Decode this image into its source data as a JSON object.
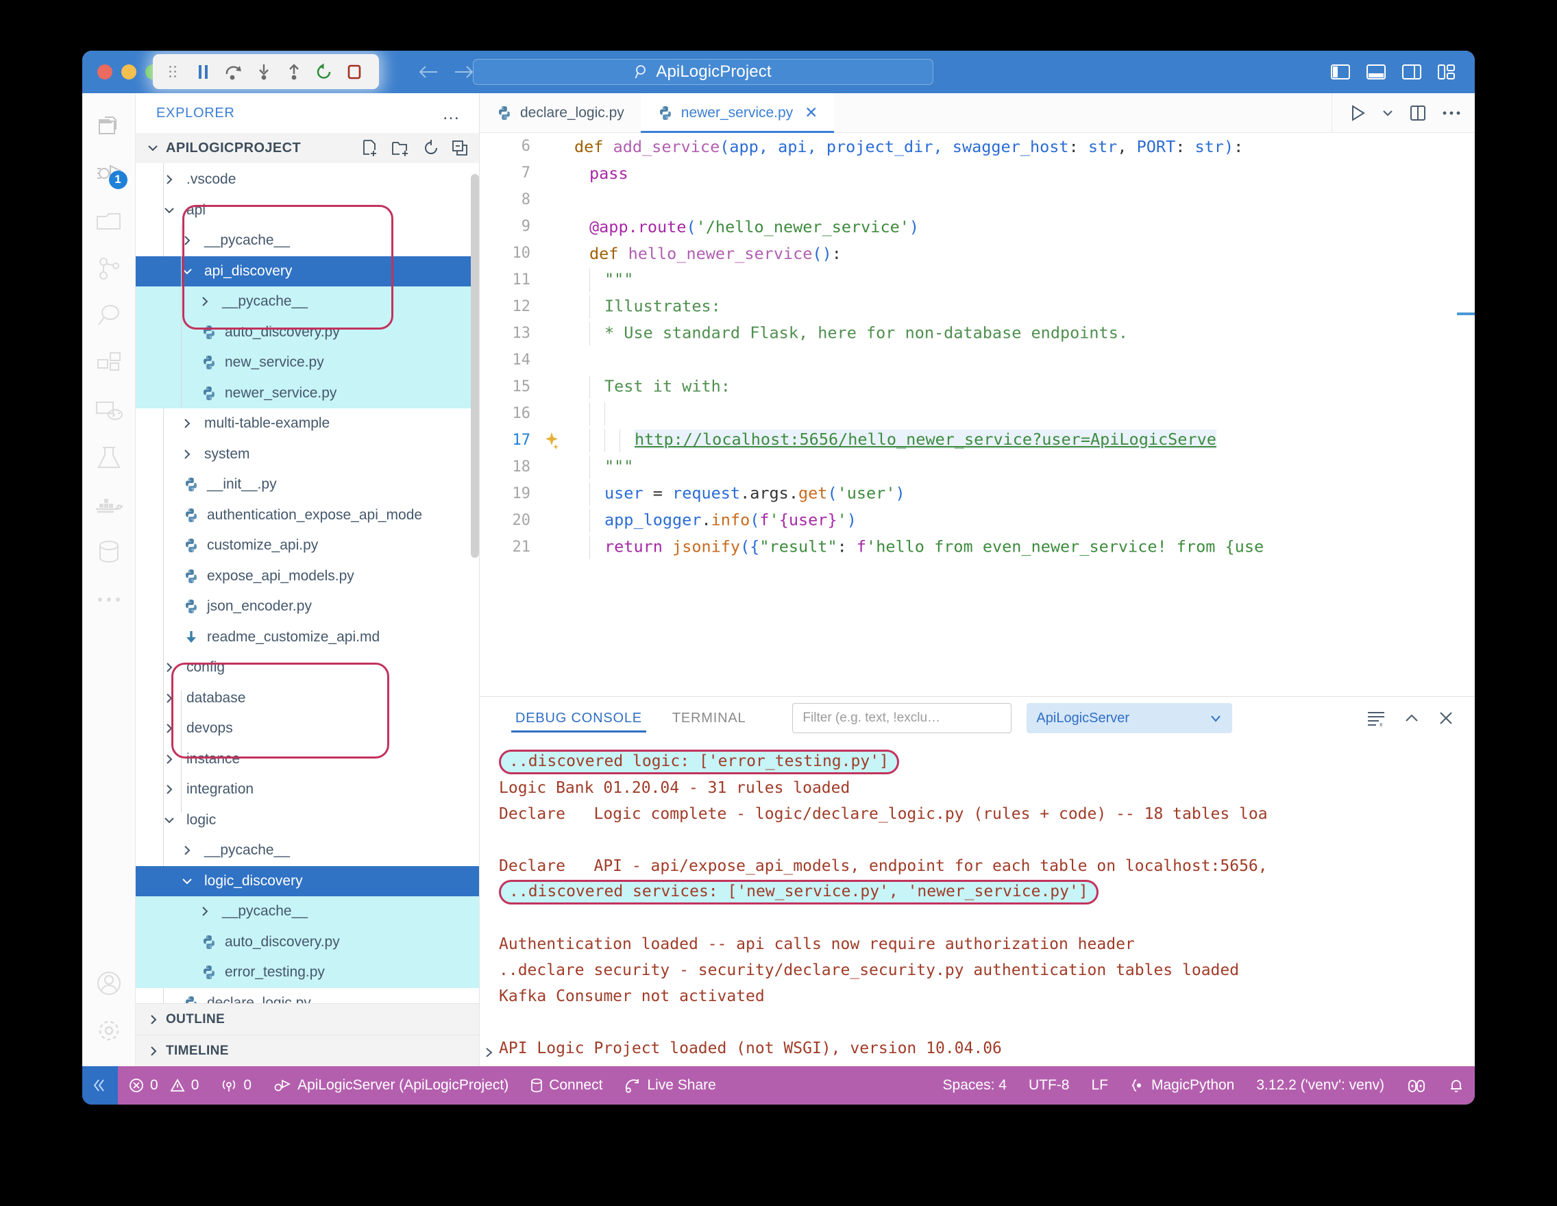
{
  "titlebar": {
    "project_title": "ApiLogicProject",
    "search_icon": "search-icon",
    "debug_buttons": [
      {
        "name": "drag-handle",
        "label": "drag"
      },
      {
        "name": "pause-button",
        "label": "Pause"
      },
      {
        "name": "step-over-button",
        "label": "Step Over"
      },
      {
        "name": "step-into-button",
        "label": "Step Into"
      },
      {
        "name": "step-out-button",
        "label": "Step Out"
      },
      {
        "name": "restart-button",
        "label": "Restart"
      },
      {
        "name": "stop-button",
        "label": "Stop"
      }
    ],
    "nav_back": "back-arrow-icon",
    "nav_forward": "forward-arrow-icon",
    "layout_icons": [
      "toggle-primary-sidebar-icon",
      "toggle-panel-icon",
      "toggle-secondary-sidebar-icon",
      "customize-layout-icon"
    ]
  },
  "activitybar": {
    "items": [
      {
        "name": "explorer",
        "badge": ""
      },
      {
        "name": "run-and-debug",
        "badge": "1"
      },
      {
        "name": "source-control",
        "badge": ""
      },
      {
        "name": "git-graph",
        "badge": ""
      },
      {
        "name": "search",
        "badge": ""
      },
      {
        "name": "extensions",
        "badge": ""
      },
      {
        "name": "remote-explorer",
        "badge": ""
      },
      {
        "name": "testing",
        "badge": ""
      },
      {
        "name": "docker",
        "badge": ""
      },
      {
        "name": "database",
        "badge": ""
      },
      {
        "name": "more-views",
        "badge": ""
      }
    ],
    "bottom": [
      {
        "name": "accounts"
      },
      {
        "name": "manage-settings"
      }
    ]
  },
  "sidebar": {
    "header_label": "EXPLORER",
    "more_actions": "…",
    "project_name": "APILOGICPROJECT",
    "project_actions": [
      "new-file-icon",
      "new-folder-icon",
      "refresh-icon",
      "collapse-all-icon"
    ],
    "tree": [
      {
        "label": ".vscode",
        "kind": "folder",
        "depth": 1,
        "expanded": false
      },
      {
        "label": "api",
        "kind": "folder",
        "depth": 1,
        "expanded": true
      },
      {
        "label": "__pycache__",
        "kind": "folder",
        "depth": 2,
        "expanded": false
      },
      {
        "label": "api_discovery",
        "kind": "folder",
        "depth": 2,
        "expanded": true,
        "selected": true,
        "highlighted": true
      },
      {
        "label": "__pycache__",
        "kind": "folder",
        "depth": 3,
        "expanded": false,
        "highlighted": true
      },
      {
        "label": "auto_discovery.py",
        "kind": "python",
        "depth": 3,
        "highlighted": true
      },
      {
        "label": "new_service.py",
        "kind": "python",
        "depth": 3,
        "highlighted": true
      },
      {
        "label": "newer_service.py",
        "kind": "python",
        "depth": 3,
        "highlighted": true
      },
      {
        "label": "multi-table-example",
        "kind": "folder",
        "depth": 2,
        "expanded": false
      },
      {
        "label": "system",
        "kind": "folder",
        "depth": 2,
        "expanded": false
      },
      {
        "label": "__init__.py",
        "kind": "python",
        "depth": 2
      },
      {
        "label": "authentication_expose_api_mode",
        "kind": "python",
        "depth": 2
      },
      {
        "label": "customize_api.py",
        "kind": "python",
        "depth": 2
      },
      {
        "label": "expose_api_models.py",
        "kind": "python",
        "depth": 2
      },
      {
        "label": "json_encoder.py",
        "kind": "python",
        "depth": 2
      },
      {
        "label": "readme_customize_api.md",
        "kind": "markdown",
        "depth": 2
      },
      {
        "label": "config",
        "kind": "folder",
        "depth": 1,
        "expanded": false
      },
      {
        "label": "database",
        "kind": "folder",
        "depth": 1,
        "expanded": false
      },
      {
        "label": "devops",
        "kind": "folder",
        "depth": 1,
        "expanded": false
      },
      {
        "label": "instance",
        "kind": "folder",
        "depth": 1,
        "expanded": false
      },
      {
        "label": "integration",
        "kind": "folder",
        "depth": 1,
        "expanded": false
      },
      {
        "label": "logic",
        "kind": "folder",
        "depth": 1,
        "expanded": true
      },
      {
        "label": "__pycache__",
        "kind": "folder",
        "depth": 2,
        "expanded": false
      },
      {
        "label": "logic_discovery",
        "kind": "folder",
        "depth": 2,
        "expanded": true,
        "selected": true,
        "highlighted": true
      },
      {
        "label": "__pycache__",
        "kind": "folder",
        "depth": 3,
        "expanded": false,
        "highlighted": true
      },
      {
        "label": "auto_discovery.py",
        "kind": "python",
        "depth": 3,
        "highlighted": true
      },
      {
        "label": "error_testing.py",
        "kind": "python",
        "depth": 3,
        "highlighted": true
      },
      {
        "label": "declare_logic.py",
        "kind": "python",
        "depth": 2
      }
    ],
    "sections": [
      {
        "label": "OUTLINE",
        "expanded": false
      },
      {
        "label": "TIMELINE",
        "expanded": false
      }
    ]
  },
  "editor": {
    "tabs": [
      {
        "label": "declare_logic.py",
        "active": false,
        "closable": false
      },
      {
        "label": "newer_service.py",
        "active": true,
        "closable": true
      }
    ],
    "actions": [
      "run-python-file-icon",
      "run-dropdown-icon",
      "split-editor-icon",
      "more-actions-icon"
    ],
    "lines": [
      {
        "num": "6",
        "tokens": [
          {
            "t": "def ",
            "c": "kd"
          },
          {
            "t": "add_service",
            "c": "fn"
          },
          {
            "t": "(",
            "c": "par"
          },
          {
            "t": "app, api, project_dir, swagger_host",
            "c": "vr"
          },
          {
            "t": ": ",
            "c": "op"
          },
          {
            "t": "str",
            "c": "vr"
          },
          {
            "t": ", ",
            "c": "op"
          },
          {
            "t": "PORT",
            "c": "vr"
          },
          {
            "t": ": ",
            "c": "op"
          },
          {
            "t": "str",
            "c": "vr"
          },
          {
            "t": ")",
            "c": "par"
          },
          {
            "t": ":",
            "c": "op"
          }
        ]
      },
      {
        "num": "7",
        "indent": 1,
        "tokens": [
          {
            "t": "pass",
            "c": "k"
          }
        ]
      },
      {
        "num": "8",
        "tokens": []
      },
      {
        "num": "9",
        "indent": 1,
        "tokens": [
          {
            "t": "@app",
            "c": "k"
          },
          {
            "t": ".route",
            "c": "k"
          },
          {
            "t": "(",
            "c": "par"
          },
          {
            "t": "'/hello_newer_service'",
            "c": "st"
          },
          {
            "t": ")",
            "c": "par"
          }
        ]
      },
      {
        "num": "10",
        "indent": 1,
        "tokens": [
          {
            "t": "def ",
            "c": "kd"
          },
          {
            "t": "hello_newer_service",
            "c": "fn"
          },
          {
            "t": "(",
            "c": "par"
          },
          {
            "t": ")",
            "c": "par"
          },
          {
            "t": ":",
            "c": "op"
          }
        ]
      },
      {
        "num": "11",
        "indent": 2,
        "tokens": [
          {
            "t": "\"\"\"",
            "c": "cm"
          }
        ]
      },
      {
        "num": "12",
        "indent": 2,
        "tokens": [
          {
            "t": "Illustrates:",
            "c": "cm"
          }
        ]
      },
      {
        "num": "13",
        "indent": 2,
        "tokens": [
          {
            "t": "* Use standard Flask, here for non-database endpoints.",
            "c": "cm"
          }
        ]
      },
      {
        "num": "14",
        "tokens": []
      },
      {
        "num": "15",
        "indent": 2,
        "tokens": [
          {
            "t": "Test it with:",
            "c": "cm"
          }
        ]
      },
      {
        "num": "16",
        "indent": 3,
        "tokens": []
      },
      {
        "num": "17",
        "indent": 4,
        "current": true,
        "sparkle": true,
        "tokens": [
          {
            "t": "http://localhost:5656/hello_newer_service?user=ApiLogicServe",
            "c": "url"
          }
        ]
      },
      {
        "num": "18",
        "indent": 2,
        "tokens": [
          {
            "t": "\"\"\"",
            "c": "cm"
          }
        ]
      },
      {
        "num": "19",
        "indent": 2,
        "tokens": [
          {
            "t": "user ",
            "c": "vr"
          },
          {
            "t": "= ",
            "c": "op"
          },
          {
            "t": "request",
            "c": "vr"
          },
          {
            "t": ".args.",
            "c": "op"
          },
          {
            "t": "get",
            "c": "fnc"
          },
          {
            "t": "(",
            "c": "par"
          },
          {
            "t": "'user'",
            "c": "st"
          },
          {
            "t": ")",
            "c": "par"
          }
        ]
      },
      {
        "num": "20",
        "indent": 2,
        "tokens": [
          {
            "t": "app_logger",
            "c": "vr"
          },
          {
            "t": ".",
            "c": "op"
          },
          {
            "t": "info",
            "c": "fnc"
          },
          {
            "t": "(",
            "c": "par"
          },
          {
            "t": "f",
            "c": "k"
          },
          {
            "t": "'",
            "c": "st"
          },
          {
            "t": "{user}",
            "c": "k"
          },
          {
            "t": "'",
            "c": "st"
          },
          {
            "t": ")",
            "c": "par"
          }
        ]
      },
      {
        "num": "21",
        "indent": 2,
        "tokens": [
          {
            "t": "return ",
            "c": "k"
          },
          {
            "t": "jsonify",
            "c": "fnc"
          },
          {
            "t": "(",
            "c": "par"
          },
          {
            "t": "{",
            "c": "par"
          },
          {
            "t": "\"result\"",
            "c": "st"
          },
          {
            "t": ": ",
            "c": "op"
          },
          {
            "t": "f",
            "c": "k"
          },
          {
            "t": "'hello from even_newer_service! from {use",
            "c": "st"
          }
        ]
      }
    ]
  },
  "panel": {
    "tabs": [
      {
        "label": "DEBUG CONSOLE",
        "active": true
      },
      {
        "label": "TERMINAL",
        "active": false
      }
    ],
    "filter_placeholder": "Filter (e.g. text, !exclu…",
    "session": "ApiLogicServer",
    "actions": [
      "clear-console-icon",
      "collapse-panel-icon",
      "close-panel-icon"
    ],
    "console_lines": [
      {
        "text": "..discovered logic: ['error_testing.py']",
        "highlighted": true
      },
      {
        "text": "Logic Bank 01.20.04 - 31 rules loaded"
      },
      {
        "text": "Declare   Logic complete - logic/declare_logic.py (rules + code) -- 18 tables loa"
      },
      {
        "text": ""
      },
      {
        "text": "Declare   API - api/expose_api_models, endpoint for each table on localhost:5656,"
      },
      {
        "text": "..discovered services: ['new_service.py', 'newer_service.py']",
        "highlighted": true
      },
      {
        "text": ""
      },
      {
        "text": "Authentication loaded -- api calls now require authorization header"
      },
      {
        "text": "..declare security - security/declare_security.py authentication tables loaded"
      },
      {
        "text": "Kafka Consumer not activated"
      },
      {
        "text": ""
      },
      {
        "text": "API Logic Project loaded (not WSGI), version 10.04.06"
      }
    ]
  },
  "statusbar": {
    "remote_icon": "remote-window-icon",
    "errors": "0",
    "warnings": "0",
    "ports": "0",
    "debug_session": "ApiLogicServer (ApiLogicProject)",
    "connect": "Connect",
    "live_share": "Live Share",
    "spaces": "Spaces: 4",
    "encoding": "UTF-8",
    "eol": "LF",
    "language": "MagicPython",
    "interpreter": "3.12.2 ('venv': venv)",
    "right_icons": [
      "copilot-icon",
      "notifications-bell-icon"
    ]
  },
  "colors": {
    "titlebar": "#3c7fcc",
    "accent": "#3b7fd4",
    "selection": "#3072c4",
    "highlight": "#c7f4f7",
    "annotation": "#c2335c",
    "statusbar": "#b45fae",
    "console_text": "#a03c28"
  }
}
